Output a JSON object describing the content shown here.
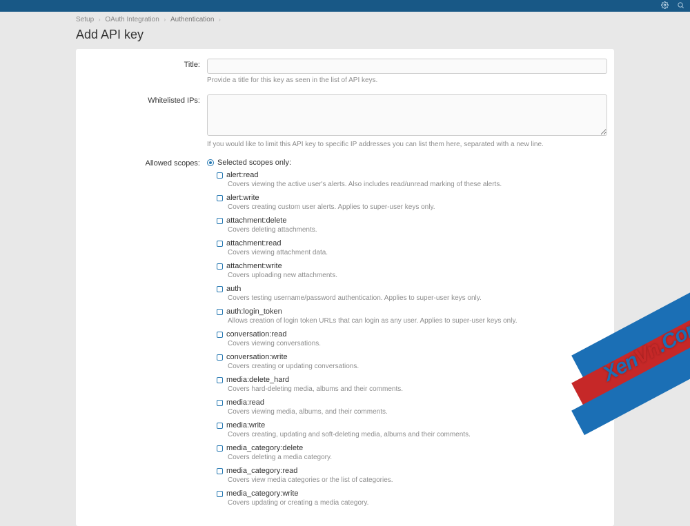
{
  "breadcrumbs": {
    "items": [
      {
        "label": "Setup"
      },
      {
        "label": "OAuth Integration"
      },
      {
        "label": "Authentication"
      }
    ]
  },
  "page": {
    "title": "Add API key"
  },
  "form": {
    "title_label": "Title:",
    "title_value": "",
    "title_hint": "Provide a title for this key as seen in the list of API keys.",
    "ips_label": "Whitelisted IPs:",
    "ips_value": "",
    "ips_hint": "If you would like to limit this API key to specific IP addresses you can list them here, separated with a new line.",
    "scopes_label": "Allowed scopes:",
    "scopes_radio_label": "Selected scopes only:"
  },
  "scopes": [
    {
      "name": "alert:read",
      "desc": "Covers viewing the active user's alerts. Also includes read/unread marking of these alerts."
    },
    {
      "name": "alert:write",
      "desc": "Covers creating custom user alerts. Applies to super-user keys only."
    },
    {
      "name": "attachment:delete",
      "desc": "Covers deleting attachments."
    },
    {
      "name": "attachment:read",
      "desc": "Covers viewing attachment data."
    },
    {
      "name": "attachment:write",
      "desc": "Covers uploading new attachments."
    },
    {
      "name": "auth",
      "desc": "Covers testing username/password authentication. Applies to super-user keys only."
    },
    {
      "name": "auth:login_token",
      "desc": "Allows creation of login token URLs that can login as any user. Applies to super-user keys only."
    },
    {
      "name": "conversation:read",
      "desc": "Covers viewing conversations."
    },
    {
      "name": "conversation:write",
      "desc": "Covers creating or updating conversations."
    },
    {
      "name": "media:delete_hard",
      "desc": "Covers hard-deleting media, albums and their comments."
    },
    {
      "name": "media:read",
      "desc": "Covers viewing media, albums, and their comments."
    },
    {
      "name": "media:write",
      "desc": "Covers creating, updating and soft-deleting media, albums and their comments."
    },
    {
      "name": "media_category:delete",
      "desc": "Covers deleting a media category."
    },
    {
      "name": "media_category:read",
      "desc": "Covers view media categories or the list of categories."
    },
    {
      "name": "media_category:write",
      "desc": "Covers updating or creating a media category."
    }
  ],
  "watermark": {
    "part1": "Xen",
    "part2": "Vn",
    "part3": ".Com"
  }
}
